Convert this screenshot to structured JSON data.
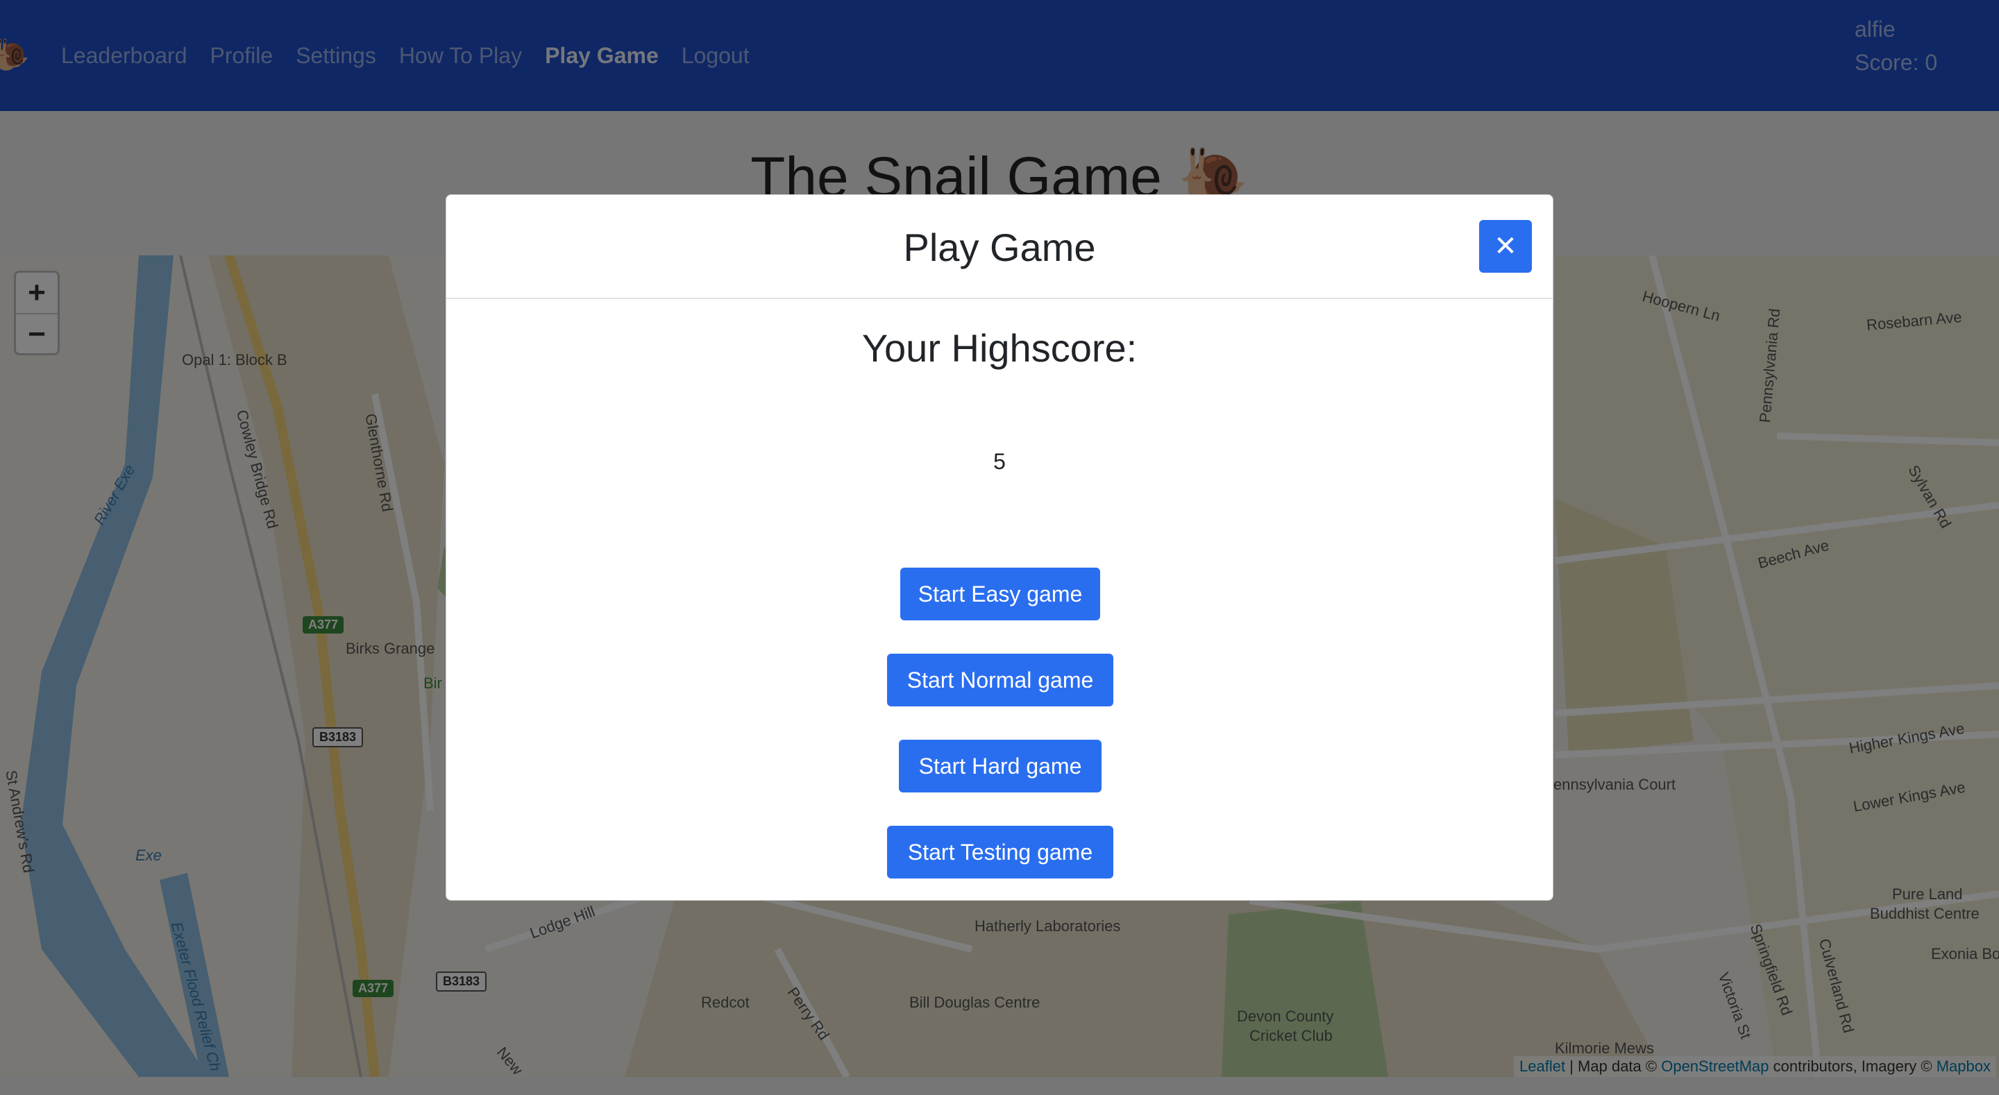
{
  "navbar": {
    "logo_emoji": "🐌",
    "links": [
      {
        "label": "Leaderboard"
      },
      {
        "label": "Profile"
      },
      {
        "label": "Settings"
      },
      {
        "label": "How To Play"
      },
      {
        "label": "Play Game",
        "active": true
      },
      {
        "label": "Logout"
      }
    ],
    "username": "alfie",
    "score_text": "Score: 0"
  },
  "page": {
    "title": "The Snail Game 🐌"
  },
  "map": {
    "zoom_in": "+",
    "zoom_out": "−",
    "labels": {
      "opal": "Opal 1: Block B",
      "cowley": "Cowley Bridge Rd",
      "glenthorne": "Glenthorne Rd",
      "river_exe": "River Exe",
      "birks": "Birks Grange",
      "bir": "Bir",
      "st_andrews": "St Andrew's Rd",
      "exe": "Exe",
      "flood": "Exeter Flood Relief Ch",
      "lodge": "Lodge Hill",
      "redcot": "Redcot",
      "perry": "Perry Rd",
      "new": "New",
      "hatherly": "Hatherly Laboratories",
      "bill_douglas": "Bill Douglas Centre",
      "devon_county": "Devon County",
      "cricket_club": "Cricket Club",
      "kilmorie": "Kilmorie Mews",
      "hoopern": "Hoopern Ln",
      "pennsylvania_rd": "Pennsylvania Rd",
      "rosebarn": "Rosebarn Ave",
      "sylvan": "Sylvan Rd",
      "beech": "Beech Ave",
      "pennsylvania_court": "ennsylvania Court",
      "higher_kings": "Higher Kings Ave",
      "lower_kings": "Lower Kings Ave",
      "pure_land": "Pure Land",
      "buddhist": "Buddhist Centre",
      "exonia": "Exonia Bo",
      "springfield": "Springfield Rd",
      "victoria": "Victoria St",
      "culverland": "Culverland Rd"
    },
    "badges": {
      "a377_1": "A377",
      "a377_2": "A377",
      "b3183_1": "B3183",
      "b3183_2": "B3183"
    },
    "attribution": {
      "leaflet": "Leaflet",
      "sep": " | Map data © ",
      "osm": "OpenStreetMap",
      "mid": " contributors, Imagery © ",
      "mapbox": "Mapbox"
    }
  },
  "modal": {
    "title": "Play Game",
    "close_symbol": "✕",
    "highscore_label": "Your Highscore:",
    "highscore_value": "5",
    "buttons": {
      "easy": "Start Easy game",
      "normal": "Start Normal game",
      "hard": "Start Hard game",
      "testing": "Start Testing game"
    }
  },
  "colors": {
    "navbar": "#1f4fc9",
    "primary_button": "#2a6ef0"
  }
}
